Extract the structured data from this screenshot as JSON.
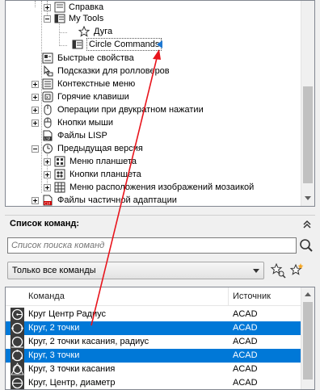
{
  "tree": {
    "items": [
      {
        "label": "Справка",
        "icon": "help-icon"
      },
      {
        "label": "My Tools",
        "icon": "toolbar-icon"
      },
      {
        "label": "Дуга",
        "icon": "star-icon"
      },
      {
        "label": "Circle Commands",
        "icon": "toolbar-icon",
        "selected": true
      },
      {
        "label": "Быстрые свойства",
        "icon": "quick-properties-icon"
      },
      {
        "label": "Подсказки для ролловеров",
        "icon": "rollover-tooltip-icon"
      },
      {
        "label": "Контекстные меню",
        "icon": "context-menu-icon"
      },
      {
        "label": "Горячие клавиши",
        "icon": "keyboard-icon"
      },
      {
        "label": "Операции при двукратном нажатии",
        "icon": "double-click-icon"
      },
      {
        "label": "Кнопки мыши",
        "icon": "mouse-icon"
      },
      {
        "label": "Файлы LISP",
        "icon": "lisp-file-icon"
      },
      {
        "label": "Предыдущая версия",
        "icon": "legacy-icon"
      },
      {
        "label": "Меню планшета",
        "icon": "tablet-menu-icon"
      },
      {
        "label": "Кнопки планшета",
        "icon": "tablet-buttons-icon"
      },
      {
        "label": "Меню расположения изображений мозаикой",
        "icon": "image-tile-menu-icon"
      },
      {
        "label": "Файлы частичной адаптации",
        "icon": "partial-cui-icon"
      }
    ]
  },
  "command_list": {
    "title": "Список команд:",
    "search_placeholder": "Список поиска команд",
    "filter_value": "Только все команды",
    "columns": [
      "Команда",
      "Источник"
    ],
    "rows": [
      {
        "command": "Круг Центр Радиус",
        "source": "ACAD",
        "selected": false
      },
      {
        "command": "Круг, 2 точки",
        "source": "ACAD",
        "selected": true
      },
      {
        "command": "Круг, 2 точки касания, радиус",
        "source": "ACAD",
        "selected": false
      },
      {
        "command": "Круг, 3 точки",
        "source": "ACAD",
        "selected": true
      },
      {
        "command": "Круг, 3 точки касания",
        "source": "ACAD",
        "selected": false
      },
      {
        "command": "Круг, Центр, диаметр",
        "source": "ACAD",
        "selected": false
      }
    ]
  },
  "colors": {
    "selection": "#0078d7",
    "annotation_arrow": "#e8141c",
    "insertion_marker": "#1e78d2"
  }
}
